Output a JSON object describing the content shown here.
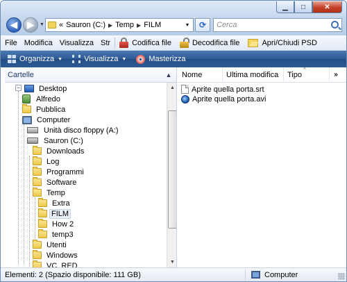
{
  "window": {
    "caption_buttons": [
      "minimize",
      "maximize",
      "close"
    ]
  },
  "address_bar": {
    "prefix": "«",
    "crumbs": [
      "Sauron (C:)",
      "Temp",
      "FILM"
    ]
  },
  "search": {
    "placeholder": "Cerca"
  },
  "menu": {
    "items": [
      {
        "label": "File"
      },
      {
        "label": "Modifica"
      },
      {
        "label": "Visualizza"
      },
      {
        "label": "Str"
      }
    ],
    "tools": [
      {
        "label": "Codifica file",
        "icon": "red-lock-icon"
      },
      {
        "label": "Decodifica file",
        "icon": "gold-lock-icon"
      },
      {
        "label": "Apri/Chiudi PSD",
        "icon": "open-folder-icon"
      }
    ]
  },
  "command_bar": {
    "organize": "Organizza",
    "view": "Visualizza",
    "burn": "Masterizza"
  },
  "left_pane": {
    "header": "Cartelle",
    "tree": [
      {
        "label": "Desktop",
        "icon": "desktop-icon"
      },
      {
        "label": "Alfredo",
        "icon": "user-icon"
      },
      {
        "label": "Pubblica",
        "icon": "folder-icon"
      },
      {
        "label": "Computer",
        "icon": "computer-icon"
      },
      {
        "label": "Unità disco floppy (A:)",
        "icon": "floppy-icon"
      },
      {
        "label": "Sauron (C:)",
        "icon": "drive-icon"
      },
      {
        "label": "Downloads",
        "icon": "folder-icon"
      },
      {
        "label": "Log",
        "icon": "folder-icon"
      },
      {
        "label": "Programmi",
        "icon": "folder-icon"
      },
      {
        "label": "Software",
        "icon": "folder-icon"
      },
      {
        "label": "Temp",
        "icon": "folder-icon"
      },
      {
        "label": "Extra",
        "icon": "folder-icon"
      },
      {
        "label": "FILM",
        "icon": "folder-icon",
        "selected": true
      },
      {
        "label": "How 2",
        "icon": "folder-icon"
      },
      {
        "label": "temp3",
        "icon": "folder-icon"
      },
      {
        "label": "Utenti",
        "icon": "folder-icon"
      },
      {
        "label": "Windows",
        "icon": "folder-icon"
      },
      {
        "label": "VC_RED",
        "icon": "folder-icon"
      }
    ]
  },
  "right_pane": {
    "columns": [
      "Nome",
      "Ultima modifica",
      "Tipo"
    ],
    "more": "»",
    "files": [
      {
        "name": "Aprite quella porta.srt",
        "icon": "document-icon"
      },
      {
        "name": "Aprite quella porta.avi",
        "icon": "media-file-icon"
      }
    ]
  },
  "status_bar": {
    "summary": "Elementi: 2 (Spazio disponibile: 111 GB)",
    "location": "Computer"
  }
}
